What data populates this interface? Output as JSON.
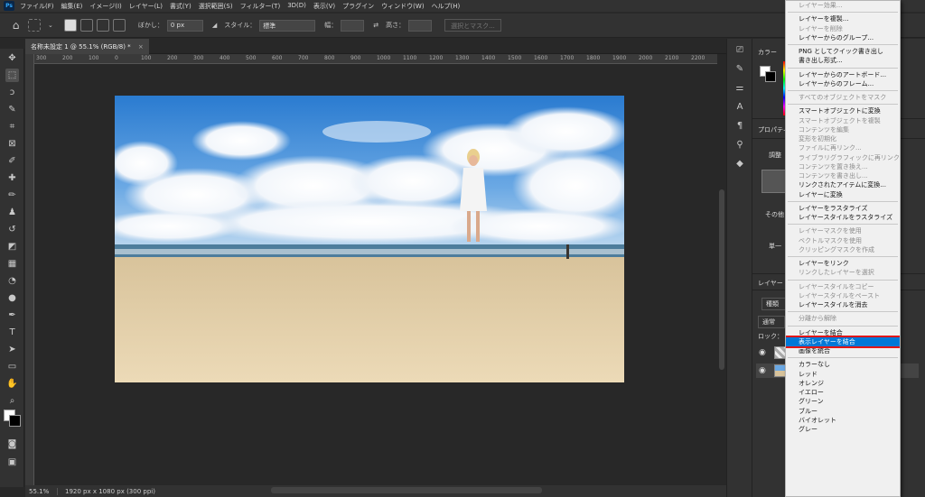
{
  "menubar": {
    "logo": "Ps",
    "items": [
      "ファイル(F)",
      "編集(E)",
      "イメージ(I)",
      "レイヤー(L)",
      "書式(Y)",
      "選択範囲(S)",
      "フィルター(T)",
      "3D(D)",
      "表示(V)",
      "プラグイン",
      "ウィンドウ(W)",
      "ヘルプ(H)"
    ]
  },
  "options": {
    "feather_label": "ぼかし：",
    "feather_value": "0 px",
    "style_label": "スタイル：",
    "style_value": "標準",
    "width_label": "幅：",
    "height_label": "高さ：",
    "select_mask": "選択とマスク..."
  },
  "document": {
    "tab_title": "名称未設定 1 @ 55.1% (RGB/8) *",
    "close": "×"
  },
  "ruler": {
    "ticks": [
      "300",
      "200",
      "100",
      "0",
      "100",
      "200",
      "300",
      "400",
      "500",
      "600",
      "700",
      "800",
      "900",
      "1000",
      "1100",
      "1200",
      "1300",
      "1400",
      "1500",
      "1600",
      "1700",
      "1800",
      "1900",
      "2000",
      "2100",
      "2200"
    ]
  },
  "status": {
    "zoom": "55.1%",
    "info": "1920 px x 1080 px (300 ppi)"
  },
  "right_panel": {
    "color_tab": "カラー",
    "properties_tab": "プロパティ",
    "adjust_label": "調整",
    "other_label": "その他",
    "single_label": "単一",
    "layers_tab": "レイヤー",
    "kind_label": "種類",
    "blend_mode": "通常",
    "lock_label": "ロック："
  },
  "context_menu": {
    "highlighted_index": 42,
    "items": [
      {
        "label": "レイヤー効果...",
        "disabled": true
      },
      {
        "sep": true
      },
      {
        "label": "レイヤーを複製...",
        "disabled": false
      },
      {
        "label": "レイヤーを削除",
        "disabled": true
      },
      {
        "label": "レイヤーからのグループ...",
        "disabled": false
      },
      {
        "sep": true
      },
      {
        "label": "PNG としてクイック書き出し",
        "disabled": false
      },
      {
        "label": "書き出し形式...",
        "disabled": false
      },
      {
        "sep": true
      },
      {
        "label": "レイヤーからのアートボード...",
        "disabled": false
      },
      {
        "label": "レイヤーからのフレーム...",
        "disabled": false
      },
      {
        "sep": true
      },
      {
        "label": "すべてのオブジェクトをマスク",
        "disabled": true
      },
      {
        "sep": true
      },
      {
        "label": "スマートオブジェクトに変換",
        "disabled": false
      },
      {
        "label": "スマートオブジェクトを複製",
        "disabled": true
      },
      {
        "label": "コンテンツを編集",
        "disabled": true
      },
      {
        "label": "変形を初期化",
        "disabled": true
      },
      {
        "label": "ファイルに再リンク...",
        "disabled": true
      },
      {
        "label": "ライブラリグラフィックに再リンク...",
        "disabled": true
      },
      {
        "label": "コンテンツを置き換え...",
        "disabled": true
      },
      {
        "label": "コンテンツを書き出し...",
        "disabled": true
      },
      {
        "label": "リンクされたアイテムに変換...",
        "disabled": false
      },
      {
        "label": "レイヤーに変換",
        "disabled": false
      },
      {
        "sep": true
      },
      {
        "label": "レイヤーをラスタライズ",
        "disabled": false
      },
      {
        "label": "レイヤースタイルをラスタライズ",
        "disabled": false
      },
      {
        "sep": true
      },
      {
        "label": "レイヤーマスクを使用",
        "disabled": true
      },
      {
        "label": "ベクトルマスクを使用",
        "disabled": true
      },
      {
        "label": "クリッピングマスクを作成",
        "disabled": true
      },
      {
        "sep": true
      },
      {
        "label": "レイヤーをリンク",
        "disabled": false
      },
      {
        "label": "リンクしたレイヤーを選択",
        "disabled": true
      },
      {
        "sep": true
      },
      {
        "label": "レイヤースタイルをコピー",
        "disabled": true
      },
      {
        "label": "レイヤースタイルをペースト",
        "disabled": true
      },
      {
        "label": "レイヤースタイルを消去",
        "disabled": false
      },
      {
        "sep": true
      },
      {
        "label": "分離から解除",
        "disabled": true
      },
      {
        "sep": true
      },
      {
        "label": "レイヤーを結合",
        "disabled": false
      },
      {
        "label": "表示レイヤーを結合",
        "disabled": false
      },
      {
        "label": "画像を統合",
        "disabled": false
      },
      {
        "sep": true
      },
      {
        "label": "カラーなし",
        "disabled": false
      },
      {
        "label": "レッド",
        "disabled": false
      },
      {
        "label": "オレンジ",
        "disabled": false
      },
      {
        "label": "イエロー",
        "disabled": false
      },
      {
        "label": "グリーン",
        "disabled": false
      },
      {
        "label": "ブルー",
        "disabled": false
      },
      {
        "label": "バイオレット",
        "disabled": false
      },
      {
        "label": "グレー",
        "disabled": false
      }
    ]
  },
  "colors": {
    "highlight": "#0078d7",
    "highlight_border": "#e01616",
    "app_bg": "#282828",
    "panel_bg": "#323232"
  }
}
